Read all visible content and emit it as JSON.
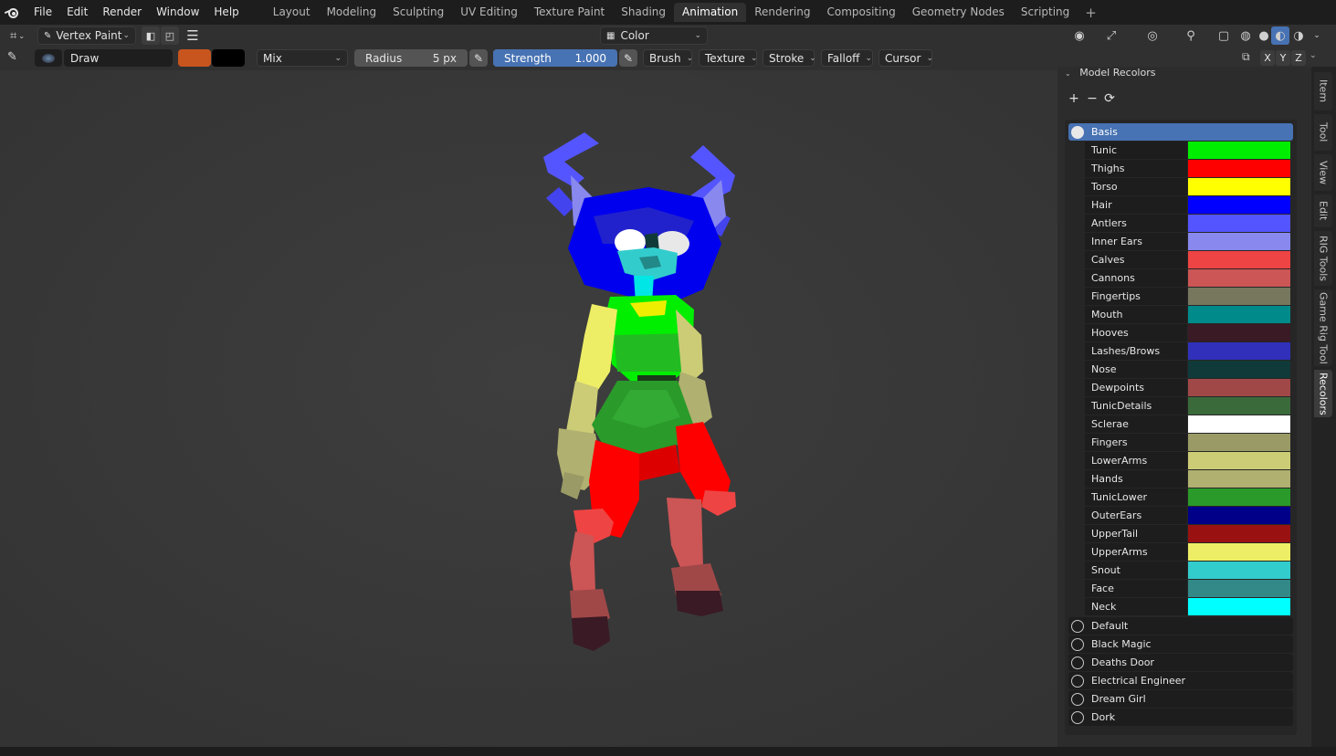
{
  "menu": [
    "File",
    "Edit",
    "Render",
    "Window",
    "Help"
  ],
  "workspaces": [
    {
      "label": "Layout",
      "active": false
    },
    {
      "label": "Modeling",
      "active": false
    },
    {
      "label": "Sculpting",
      "active": false
    },
    {
      "label": "UV Editing",
      "active": false
    },
    {
      "label": "Texture Paint",
      "active": false
    },
    {
      "label": "Shading",
      "active": false
    },
    {
      "label": "Animation",
      "active": true
    },
    {
      "label": "Rendering",
      "active": false
    },
    {
      "label": "Compositing",
      "active": false
    },
    {
      "label": "Geometry Nodes",
      "active": false
    },
    {
      "label": "Scripting",
      "active": false
    }
  ],
  "header": {
    "mode": "Vertex Paint",
    "shading_color": "Color"
  },
  "tool": {
    "brush_name": "Draw",
    "primary_color": "#c8551e",
    "secondary_color": "#000000",
    "blend_mode": "Mix",
    "radius_label": "Radius",
    "radius_value": "5 px",
    "strength_label": "Strength",
    "strength_value": "1.000",
    "strength_level": 1.0,
    "menus": [
      "Brush",
      "Texture",
      "Stroke",
      "Falloff",
      "Cursor"
    ]
  },
  "axes": [
    "X",
    "Y",
    "Z"
  ],
  "panel": {
    "title": "Model Recolors",
    "basis_label": "Basis",
    "parts": [
      {
        "name": "Tunic",
        "color": "#00ee00"
      },
      {
        "name": "Thighs",
        "color": "#ff0000"
      },
      {
        "name": "Torso",
        "color": "#ffff00"
      },
      {
        "name": "Hair",
        "color": "#0000ff"
      },
      {
        "name": "Antlers",
        "color": "#5555ff"
      },
      {
        "name": "Inner Ears",
        "color": "#8888ee"
      },
      {
        "name": "Calves",
        "color": "#ee4444"
      },
      {
        "name": "Cannons",
        "color": "#cc5555"
      },
      {
        "name": "Fingertips",
        "color": "#77775e"
      },
      {
        "name": "Mouth",
        "color": "#008a8a"
      },
      {
        "name": "Hooves",
        "color": "#3a1a24"
      },
      {
        "name": "Lashes/Brows",
        "color": "#3030bb"
      },
      {
        "name": "Nose",
        "color": "#103a3a"
      },
      {
        "name": "Dewpoints",
        "color": "#a04848"
      },
      {
        "name": "TunicDetails",
        "color": "#3a6a3a"
      },
      {
        "name": "Sclerae",
        "color": "#ffffff"
      },
      {
        "name": "Fingers",
        "color": "#9a9a66"
      },
      {
        "name": "LowerArms",
        "color": "#cccc77"
      },
      {
        "name": "Hands",
        "color": "#b0b070"
      },
      {
        "name": "TunicLower",
        "color": "#2a9a2a"
      },
      {
        "name": "OuterEars",
        "color": "#000088"
      },
      {
        "name": "UpperTail",
        "color": "#991111"
      },
      {
        "name": "UpperArms",
        "color": "#eeee66"
      },
      {
        "name": "Snout",
        "color": "#33cccc"
      },
      {
        "name": "Face",
        "color": "#338888"
      },
      {
        "name": "Neck",
        "color": "#00ffff"
      }
    ],
    "sets": [
      "Default",
      "Black Magic",
      "Deaths Door",
      "Electrical Engineer",
      "Dream Girl",
      "Dork"
    ]
  },
  "vtabs": [
    {
      "label": "Item",
      "active": false
    },
    {
      "label": "Tool",
      "active": false
    },
    {
      "label": "View",
      "active": false
    },
    {
      "label": "Edit",
      "active": false
    },
    {
      "label": "RIG Tools",
      "active": false
    },
    {
      "label": "Game Rig Tool",
      "active": false
    },
    {
      "label": "Recolors",
      "active": true
    }
  ]
}
